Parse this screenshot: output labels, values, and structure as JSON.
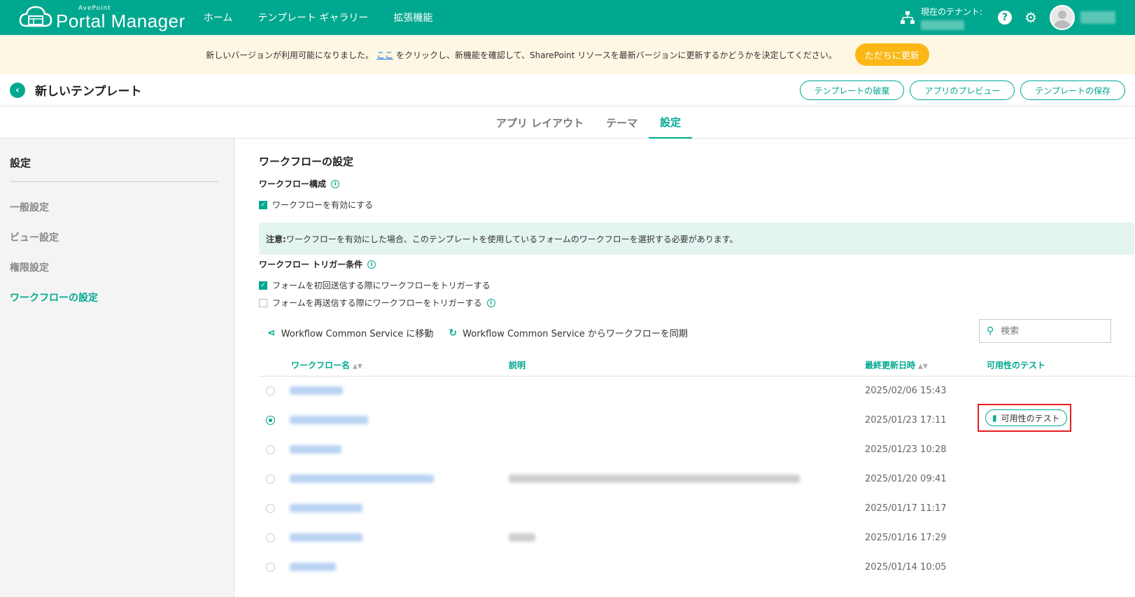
{
  "topbar": {
    "logo_small": "AvePoint",
    "logo_big": "Portal Manager",
    "nav": [
      "ホーム",
      "テンプレート ギャラリー",
      "拡張機能"
    ],
    "tenant_label": "現在のテナント:",
    "help_icon": "?",
    "settings_icon": "gear-icon"
  },
  "banner": {
    "text_before": "新しいバージョンが利用可能になりました。",
    "link": "ここ",
    "text_after": "をクリックし、新機能を確認して、SharePoint リソースを最新バージョンに更新するかどうかを決定してください。",
    "button": "ただちに更新",
    "accent": "#fbb715"
  },
  "header": {
    "title": "新しいテンプレート",
    "buttons": [
      "テンプレートの破棄",
      "アプリのプレビュー",
      "テンプレートの保存"
    ]
  },
  "tabs": [
    "アプリ レイアウト",
    "テーマ",
    "設定"
  ],
  "sidebar": {
    "title": "設定",
    "items": [
      "一般設定",
      "ビュー設定",
      "権限設定",
      "ワークフローの設定"
    ]
  },
  "main": {
    "section_title": "ワークフローの設定",
    "config_label": "ワークフロー構成",
    "enable_label": "ワークフローを有効にする",
    "note_bold": "注意:",
    "note_text": "ワークフローを有効にした場合、このテンプレートを使用しているフォームのワークフローを選択する必要があります。",
    "trigger_label": "ワークフロー トリガー条件",
    "trigger1": "フォームを初回送信する際にワークフローをトリガーする",
    "trigger2": "フォームを再送信する際にワークフローをトリガーする",
    "action1": "Workflow Common Service に移動",
    "action2": "Workflow Common Service からワークフローを同期",
    "search_placeholder": "検索"
  },
  "table": {
    "columns": [
      "ワークフロー名",
      "説明",
      "最終更新日時",
      "可用性のテスト"
    ],
    "rows": [
      {
        "date": "2025/02/06 15:43"
      },
      {
        "date": "2025/01/23 17:11",
        "test_button": "可用性のテスト"
      },
      {
        "date": "2025/01/23 10:28"
      },
      {
        "date": "2025/01/20 09:41"
      },
      {
        "date": "2025/01/17 11:17"
      },
      {
        "date": "2025/01/16 17:29"
      },
      {
        "date": "2025/01/14 10:05"
      }
    ]
  },
  "colors": {
    "primary": "#00a88f",
    "highlight": "#e61e1e"
  }
}
